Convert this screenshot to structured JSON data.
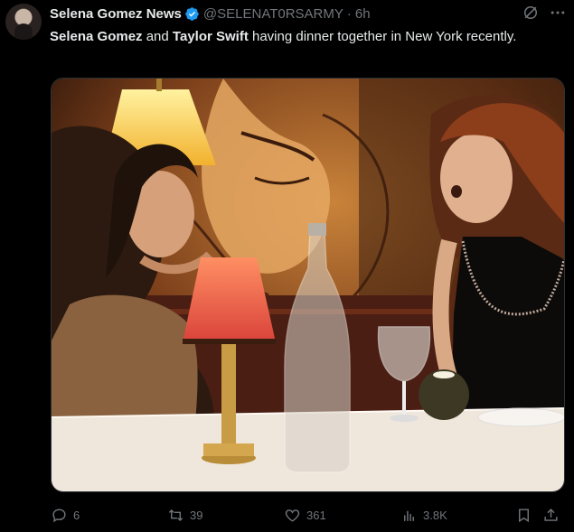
{
  "tweet": {
    "author_name": "Selena Gomez News",
    "handle": "@SELENAT0RSARMY",
    "separator": "·",
    "time": "6h",
    "text_name1": "Selena Gomez",
    "text_and": " and ",
    "text_name2": "Taylor Swift",
    "text_rest": " having dinner together in New York recently."
  },
  "actions": {
    "replies": "6",
    "retweets": "39",
    "likes": "361",
    "views": "3.8K"
  },
  "colors": {
    "background": "#000000",
    "text": "#e7e9ea",
    "secondary": "#71767b",
    "verified": "#1d9bf0"
  },
  "icons": [
    "grok-icon",
    "more-icon",
    "reply-icon",
    "retweet-icon",
    "like-icon",
    "views-icon",
    "bookmark-icon",
    "share-icon",
    "verified-badge-icon"
  ]
}
